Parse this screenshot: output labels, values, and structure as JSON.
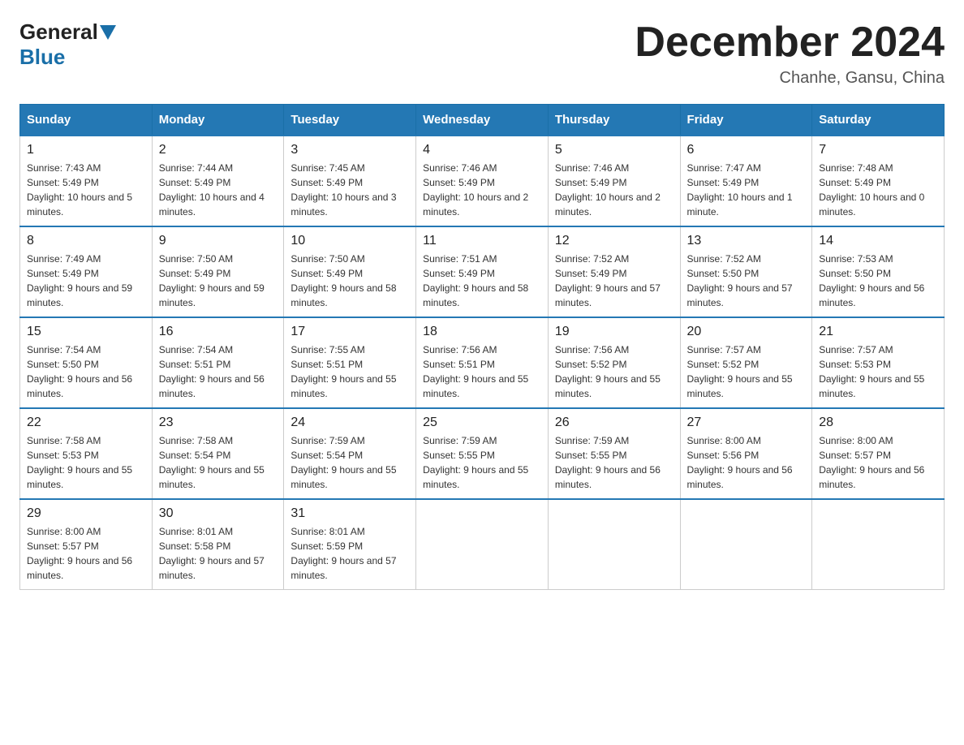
{
  "logo": {
    "general": "General",
    "blue": "Blue"
  },
  "title": "December 2024",
  "location": "Chanhe, Gansu, China",
  "days_of_week": [
    "Sunday",
    "Monday",
    "Tuesday",
    "Wednesday",
    "Thursday",
    "Friday",
    "Saturday"
  ],
  "weeks": [
    [
      {
        "day": "1",
        "sunrise": "7:43 AM",
        "sunset": "5:49 PM",
        "daylight": "10 hours and 5 minutes."
      },
      {
        "day": "2",
        "sunrise": "7:44 AM",
        "sunset": "5:49 PM",
        "daylight": "10 hours and 4 minutes."
      },
      {
        "day": "3",
        "sunrise": "7:45 AM",
        "sunset": "5:49 PM",
        "daylight": "10 hours and 3 minutes."
      },
      {
        "day": "4",
        "sunrise": "7:46 AM",
        "sunset": "5:49 PM",
        "daylight": "10 hours and 2 minutes."
      },
      {
        "day": "5",
        "sunrise": "7:46 AM",
        "sunset": "5:49 PM",
        "daylight": "10 hours and 2 minutes."
      },
      {
        "day": "6",
        "sunrise": "7:47 AM",
        "sunset": "5:49 PM",
        "daylight": "10 hours and 1 minute."
      },
      {
        "day": "7",
        "sunrise": "7:48 AM",
        "sunset": "5:49 PM",
        "daylight": "10 hours and 0 minutes."
      }
    ],
    [
      {
        "day": "8",
        "sunrise": "7:49 AM",
        "sunset": "5:49 PM",
        "daylight": "9 hours and 59 minutes."
      },
      {
        "day": "9",
        "sunrise": "7:50 AM",
        "sunset": "5:49 PM",
        "daylight": "9 hours and 59 minutes."
      },
      {
        "day": "10",
        "sunrise": "7:50 AM",
        "sunset": "5:49 PM",
        "daylight": "9 hours and 58 minutes."
      },
      {
        "day": "11",
        "sunrise": "7:51 AM",
        "sunset": "5:49 PM",
        "daylight": "9 hours and 58 minutes."
      },
      {
        "day": "12",
        "sunrise": "7:52 AM",
        "sunset": "5:49 PM",
        "daylight": "9 hours and 57 minutes."
      },
      {
        "day": "13",
        "sunrise": "7:52 AM",
        "sunset": "5:50 PM",
        "daylight": "9 hours and 57 minutes."
      },
      {
        "day": "14",
        "sunrise": "7:53 AM",
        "sunset": "5:50 PM",
        "daylight": "9 hours and 56 minutes."
      }
    ],
    [
      {
        "day": "15",
        "sunrise": "7:54 AM",
        "sunset": "5:50 PM",
        "daylight": "9 hours and 56 minutes."
      },
      {
        "day": "16",
        "sunrise": "7:54 AM",
        "sunset": "5:51 PM",
        "daylight": "9 hours and 56 minutes."
      },
      {
        "day": "17",
        "sunrise": "7:55 AM",
        "sunset": "5:51 PM",
        "daylight": "9 hours and 55 minutes."
      },
      {
        "day": "18",
        "sunrise": "7:56 AM",
        "sunset": "5:51 PM",
        "daylight": "9 hours and 55 minutes."
      },
      {
        "day": "19",
        "sunrise": "7:56 AM",
        "sunset": "5:52 PM",
        "daylight": "9 hours and 55 minutes."
      },
      {
        "day": "20",
        "sunrise": "7:57 AM",
        "sunset": "5:52 PM",
        "daylight": "9 hours and 55 minutes."
      },
      {
        "day": "21",
        "sunrise": "7:57 AM",
        "sunset": "5:53 PM",
        "daylight": "9 hours and 55 minutes."
      }
    ],
    [
      {
        "day": "22",
        "sunrise": "7:58 AM",
        "sunset": "5:53 PM",
        "daylight": "9 hours and 55 minutes."
      },
      {
        "day": "23",
        "sunrise": "7:58 AM",
        "sunset": "5:54 PM",
        "daylight": "9 hours and 55 minutes."
      },
      {
        "day": "24",
        "sunrise": "7:59 AM",
        "sunset": "5:54 PM",
        "daylight": "9 hours and 55 minutes."
      },
      {
        "day": "25",
        "sunrise": "7:59 AM",
        "sunset": "5:55 PM",
        "daylight": "9 hours and 55 minutes."
      },
      {
        "day": "26",
        "sunrise": "7:59 AM",
        "sunset": "5:55 PM",
        "daylight": "9 hours and 56 minutes."
      },
      {
        "day": "27",
        "sunrise": "8:00 AM",
        "sunset": "5:56 PM",
        "daylight": "9 hours and 56 minutes."
      },
      {
        "day": "28",
        "sunrise": "8:00 AM",
        "sunset": "5:57 PM",
        "daylight": "9 hours and 56 minutes."
      }
    ],
    [
      {
        "day": "29",
        "sunrise": "8:00 AM",
        "sunset": "5:57 PM",
        "daylight": "9 hours and 56 minutes."
      },
      {
        "day": "30",
        "sunrise": "8:01 AM",
        "sunset": "5:58 PM",
        "daylight": "9 hours and 57 minutes."
      },
      {
        "day": "31",
        "sunrise": "8:01 AM",
        "sunset": "5:59 PM",
        "daylight": "9 hours and 57 minutes."
      },
      null,
      null,
      null,
      null
    ]
  ]
}
